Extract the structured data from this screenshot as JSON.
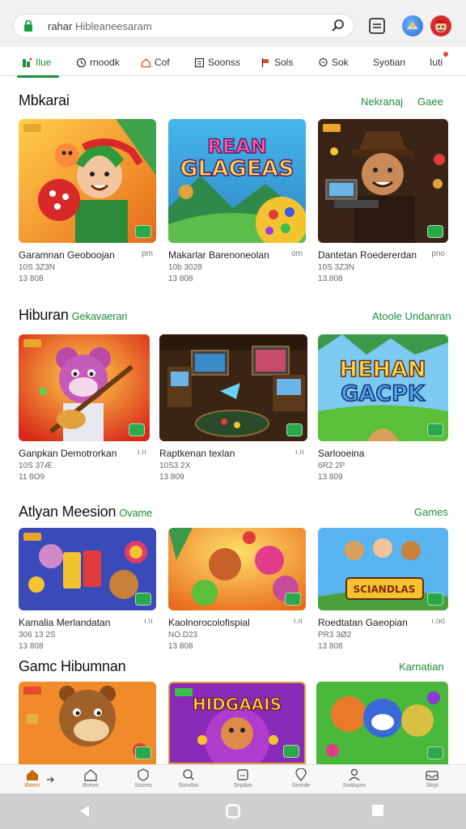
{
  "browser": {
    "url_prefix": "rahar",
    "url_text": "Hibleaneesaram"
  },
  "categories": [
    {
      "label": "Ilue",
      "icon": "home-icon",
      "active": true
    },
    {
      "label": "rnoodk",
      "icon": "clock-icon"
    },
    {
      "label": "Cof",
      "icon": "house-icon"
    },
    {
      "label": "Soonss",
      "icon": "grid-icon"
    },
    {
      "label": "Sols",
      "icon": "flag-icon"
    },
    {
      "label": "Sok",
      "icon": "chat-icon"
    },
    {
      "label": "Syotian",
      "icon": ""
    },
    {
      "label": "Iuti",
      "icon": "notification-icon"
    }
  ],
  "sections": [
    {
      "title": "Mbkarai",
      "subtitle": "",
      "link_left": "Nekranaj",
      "link_right": "Gaee",
      "cards": [
        {
          "title": "Garamnan Geoboojan",
          "meta": "pm",
          "line1": "10S 3Z3N",
          "line2": "13 808"
        },
        {
          "title": "Makarlar Barenoneolan",
          "meta": "om",
          "line1": "10b 3028",
          "line2": "13 808"
        },
        {
          "title": "Dantetan Roedererdan",
          "meta": "pno",
          "line1": "10S 3Z3N",
          "line2": "13.808"
        }
      ]
    },
    {
      "title": "Hiburan",
      "subtitle": "Gekavaerari",
      "link_left": "",
      "link_right": "Atoole Undanran",
      "cards": [
        {
          "title": "Ganpkan Demotrorkan",
          "meta": "ı.ıı",
          "line1": "10S 37Æ",
          "line2": "11 8O9"
        },
        {
          "title": "Raptkenan texlan",
          "meta": "ı.ıı",
          "line1": "10S3 2X",
          "line2": "13 809"
        },
        {
          "title": "Sarlooeina",
          "meta": "",
          "line1": "6R2 2P",
          "line2": "13 809"
        }
      ]
    },
    {
      "title": "Atlyan Meesion",
      "subtitle": "Ovame",
      "link_left": "",
      "link_right": "Games",
      "cards": [
        {
          "title": "Kamalia Merlandatan",
          "meta": "ı.ıı",
          "line1": "306 13 2S",
          "line2": "13 808"
        },
        {
          "title": "Kaolnorocolofispial",
          "meta": "ı.ıı",
          "line1": "NO.D23",
          "line2": "13 808"
        },
        {
          "title": "Roedtatan Gaeopian",
          "meta": "ı.oo",
          "line1": "PR3 3Ø2",
          "line2": "13 808"
        }
      ]
    },
    {
      "title": "Gamc Hibumnan",
      "subtitle": "",
      "link_left": "",
      "link_right": "Karnatian",
      "cards": []
    }
  ],
  "thumb_texts": {
    "s1c2": [
      "REAN",
      "GLAGEAS"
    ],
    "s2c3": [
      "HEHAN",
      "GACPK"
    ],
    "s3c3": [
      "SCIANDLAS"
    ],
    "s4c2": [
      "HIDGAAIS"
    ]
  },
  "bottom_nav": [
    {
      "label": "Boem",
      "icon": "home-icon",
      "active": true
    },
    {
      "label": "Brews",
      "icon": "house-icon"
    },
    {
      "label": "Ssores",
      "icon": "shield-icon"
    },
    {
      "label": "Sonvlon",
      "icon": "search-icon"
    },
    {
      "label": "Sirpilon",
      "icon": "box-icon"
    },
    {
      "label": "Seorde",
      "icon": "pin-icon"
    },
    {
      "label": "Soalsyon",
      "icon": "user-icon"
    },
    {
      "label": "Slopl",
      "icon": "inbox-icon"
    }
  ],
  "colors": {
    "accent": "#1a8f3a",
    "nav_bg": "#cfcfcf",
    "badge_orange": "#e9a62a"
  }
}
